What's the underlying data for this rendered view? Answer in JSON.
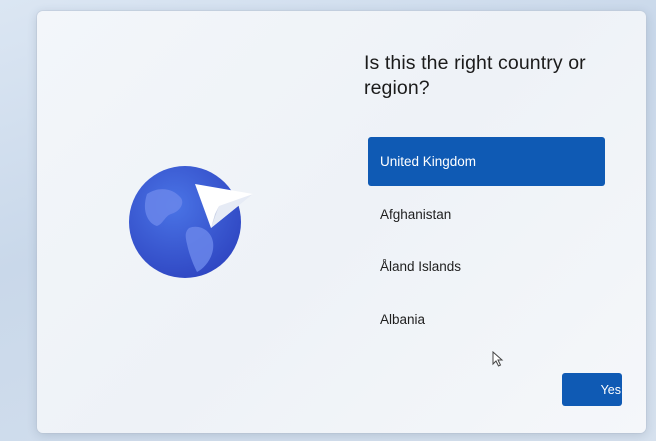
{
  "dialog": {
    "title": "Is this the right country or region?",
    "options": [
      {
        "label": "United Kingdom",
        "selected": true
      },
      {
        "label": "Afghanistan",
        "selected": false
      },
      {
        "label": "Åland Islands",
        "selected": false
      },
      {
        "label": "Albania",
        "selected": false
      }
    ],
    "yes_label": "Yes"
  },
  "illustration": {
    "icon": "globe-with-paper-plane-icon"
  },
  "colors": {
    "accent": "#0f5ab4",
    "globe": "#3d5fd6",
    "land": "#6a7fe0"
  }
}
